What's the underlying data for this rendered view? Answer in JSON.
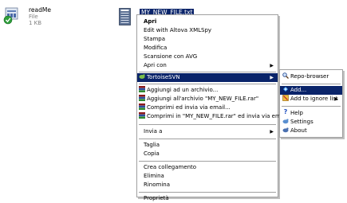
{
  "files": {
    "readme": {
      "name": "readMe",
      "type": "File",
      "size": "1 KB"
    },
    "selected_name": "MY_NEW_FILE.txt"
  },
  "menu": {
    "items": [
      "Apri",
      "Edit with Altova XMLSpy",
      "Stampa",
      "Modifica",
      "Scansione con AVG",
      "Apri con",
      "TortoiseSVN",
      "Aggiungi ad un archivio...",
      "Aggiungi all'archivio \"MY_NEW_FILE.rar\"",
      "Comprimi ed invia via email...",
      "Comprimi in \"MY_NEW_FILE.rar\" ed invia via email",
      "Invia a",
      "Taglia",
      "Copia",
      "Crea collegamento",
      "Elimina",
      "Rinomina",
      "Proprietà"
    ]
  },
  "submenu": {
    "items": [
      "Repo-browser",
      "Add...",
      "Add to ignore list",
      "Help",
      "Settings",
      "About"
    ]
  },
  "colors": {
    "highlight": "#0a246a",
    "menu_bg": "#ffffff",
    "border": "#a0a0a0"
  }
}
